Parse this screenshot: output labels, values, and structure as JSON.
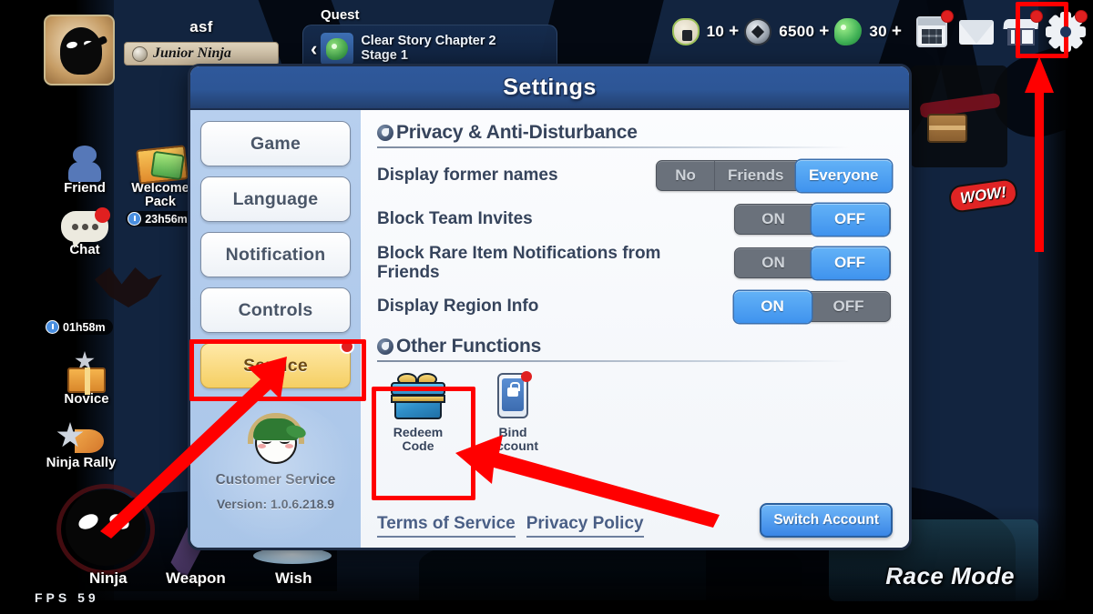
{
  "game": {
    "player": {
      "name": "asf",
      "rank": "Junior Ninja"
    },
    "quest": {
      "label": "Quest",
      "title": "Clear Story Chapter 2",
      "subtitle": "Stage 1",
      "back_arrow": "‹"
    },
    "currencies": [
      {
        "icon": "rice-ball-icon",
        "value": "10",
        "plus": "+"
      },
      {
        "icon": "coin-icon",
        "value": "6500",
        "plus": "+"
      },
      {
        "icon": "gem-icon",
        "value": "30",
        "plus": "+"
      }
    ],
    "hud_buttons": [
      {
        "name": "calendar-button",
        "badge": true
      },
      {
        "name": "mail-button",
        "badge": false
      },
      {
        "name": "shop-button",
        "badge": true
      },
      {
        "name": "settings-gear-button",
        "badge": true
      }
    ],
    "side_icons": [
      {
        "label": "Friend",
        "name": "friend-icon"
      },
      {
        "label": "Chat",
        "name": "chat-icon"
      },
      {
        "label": "Novice",
        "name": "novice-icon"
      },
      {
        "label": "Ninja Rally",
        "name": "ninja-rally-icon"
      }
    ],
    "welcome_pack": {
      "label": "Welcome Pack",
      "timer": "23h56m"
    },
    "free_timer": "01h58m",
    "bottom_tabs": [
      {
        "label": "Ninja",
        "name": "tab-ninja"
      },
      {
        "label": "Weapon",
        "name": "tab-weapon"
      },
      {
        "label": "Wish",
        "name": "tab-wish"
      }
    ],
    "wow": "WOW!",
    "race_mode": "Race Mode",
    "fps": "FPS 59"
  },
  "settings": {
    "title": "Settings",
    "nav": [
      {
        "label": "Game",
        "active": false,
        "badge": false
      },
      {
        "label": "Language",
        "active": false,
        "badge": false
      },
      {
        "label": "Notification",
        "active": false,
        "badge": false
      },
      {
        "label": "Controls",
        "active": false,
        "badge": false
      },
      {
        "label": "Service",
        "active": true,
        "badge": true
      }
    ],
    "customer_service": {
      "label": "Customer Service",
      "version": "Version: 1.0.6.218.9"
    },
    "privacy_section": {
      "heading": "Privacy & Anti-Disturbance"
    },
    "rows": [
      {
        "label": "Display former names",
        "type": "segmented",
        "options": [
          "No",
          "Friends",
          "Everyone"
        ],
        "selected": "Everyone"
      },
      {
        "label": "Block Team Invites",
        "type": "toggle",
        "options": [
          "ON",
          "OFF"
        ],
        "selected": "OFF"
      },
      {
        "label": "Block Rare Item Notifications from Friends",
        "type": "toggle",
        "options": [
          "ON",
          "OFF"
        ],
        "selected": "OFF"
      },
      {
        "label": "Display Region Info",
        "type": "toggle",
        "options": [
          "ON",
          "OFF"
        ],
        "selected": "ON"
      }
    ],
    "other_section": {
      "heading": "Other Functions"
    },
    "functions": [
      {
        "label": "Redeem Code",
        "line1": "Redeem",
        "line2": "Code",
        "icon": "gift-box-icon",
        "badge": false
      },
      {
        "label": "Bind Account",
        "line1": "Bind",
        "line2": "Account",
        "icon": "phone-lock-icon",
        "badge": true
      }
    ],
    "links": [
      {
        "label": "Terms of Service"
      },
      {
        "label": "Privacy Policy"
      }
    ],
    "switch_account": "Switch Account"
  },
  "annotations": {
    "highlight_color": "#ff0000",
    "boxes": [
      "settings-gear-button",
      "service-nav-button",
      "redeem-code-button"
    ],
    "arrows": [
      "arrow-to-gear",
      "arrow-to-service",
      "arrow-to-redeem-code"
    ]
  }
}
